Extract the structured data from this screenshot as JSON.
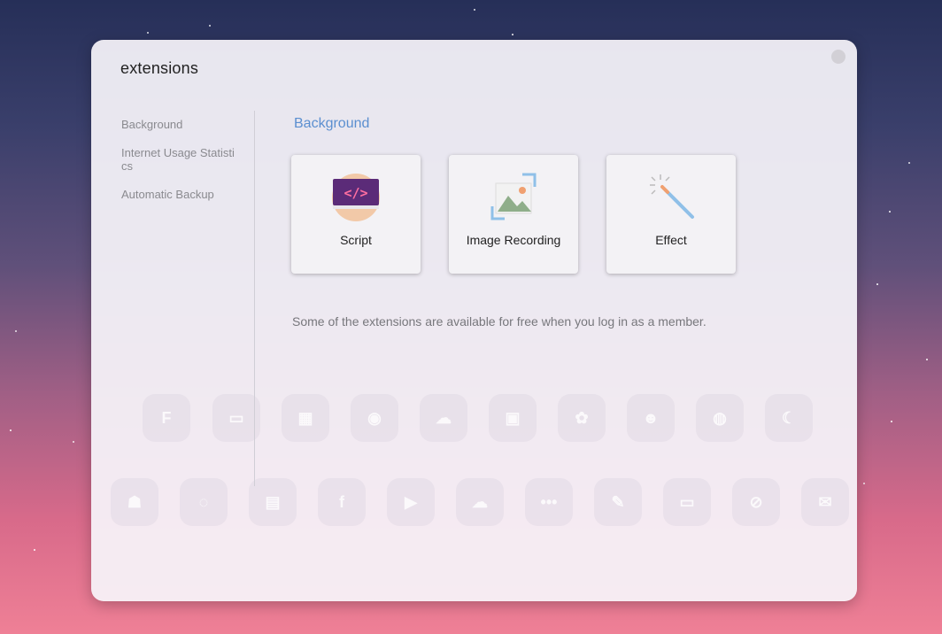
{
  "modal": {
    "title": "extensions"
  },
  "sidebar": {
    "items": [
      {
        "label": "Background"
      },
      {
        "label": "Internet Usage Statistics"
      },
      {
        "label": "Automatic Backup"
      }
    ]
  },
  "main": {
    "section_title": "Background",
    "cards": [
      {
        "label": "Script",
        "icon": "code-window-icon"
      },
      {
        "label": "Image Recording",
        "icon": "image-capture-icon"
      },
      {
        "label": "Effect",
        "icon": "magic-wand-icon"
      }
    ],
    "note": "Some of the extensions are available for free when you log in as a member."
  },
  "colors": {
    "accent": "#5b8fd0",
    "script_window": "#5b2b78",
    "script_glyph": "#ff6fa0",
    "image_frame": "#8fc0e8",
    "wand": "#8fc0e8"
  }
}
